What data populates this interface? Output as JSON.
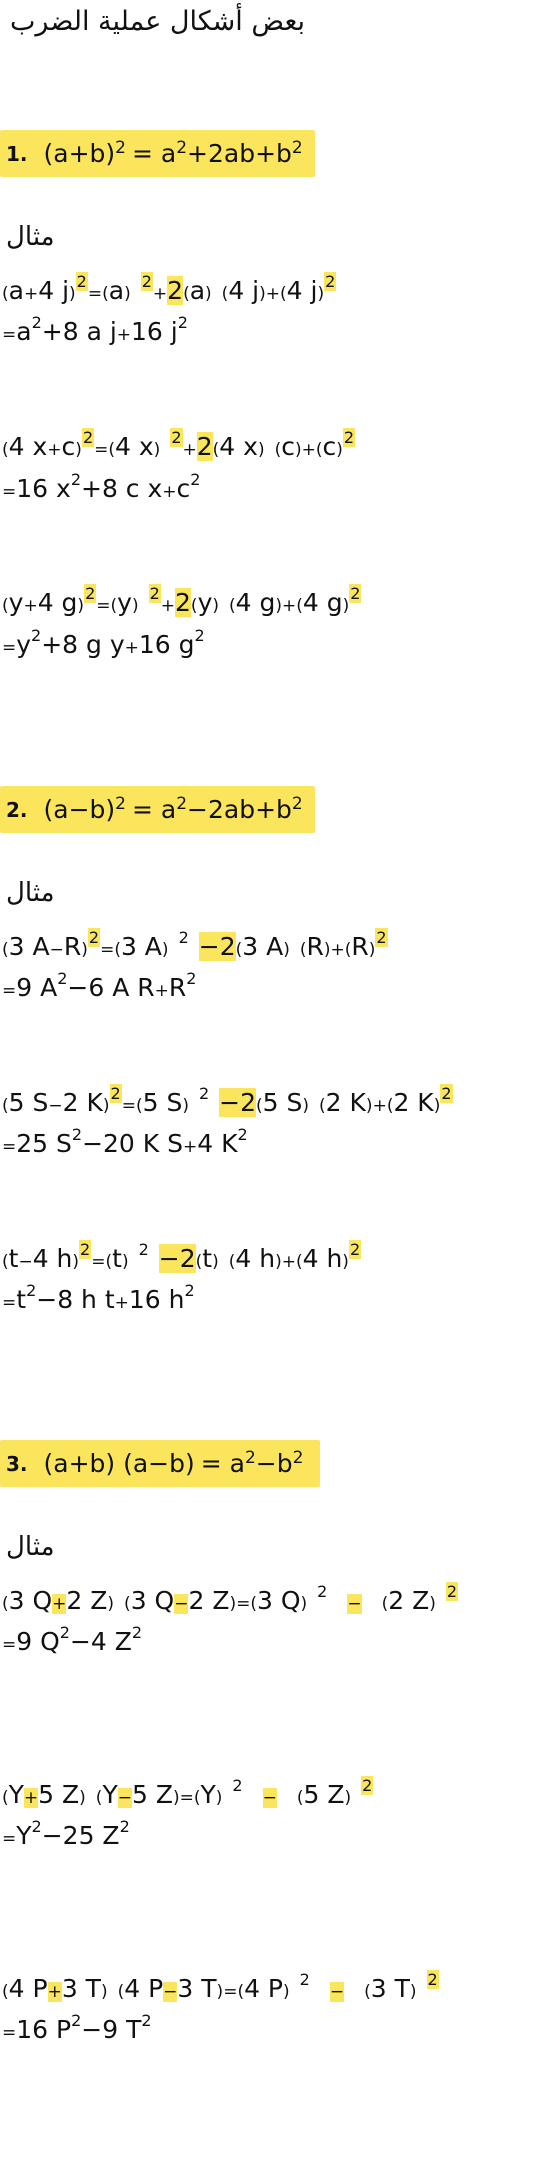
{
  "title": "بعض أشكال عملية الضرب",
  "example_label": "مثال",
  "sections": [
    {
      "num": "1.",
      "formula": {
        "a": "(a+b)",
        "b": "2",
        "c": "=  a",
        "d": "2",
        "e": "+2ab+b",
        "f": "2"
      },
      "examples": [
        {
          "l1": [
            "(",
            "a",
            "+",
            "4 j",
            ")",
            "2",
            "=",
            "(",
            "a",
            ")",
            "2",
            "+",
            "2",
            "(",
            "a",
            ")",
            "(",
            "4 j",
            ")",
            "+",
            "(",
            "4 j",
            ")",
            "2"
          ],
          "l2": [
            "=",
            "a",
            "2",
            "+8 a j",
            "+",
            "16 j",
            "2"
          ]
        },
        {
          "l1": [
            "(",
            "4 x",
            "+",
            "c",
            ")",
            "2",
            "=",
            "(",
            "4 x",
            ")",
            "2",
            "+",
            "2",
            "(",
            "4 x",
            ")",
            "(",
            "c",
            ")",
            "+",
            "(",
            "c",
            ")",
            "2"
          ],
          "l2": [
            "=",
            "16 x",
            "2",
            "+8 c x",
            "+",
            "c",
            "2"
          ]
        },
        {
          "l1": [
            "(",
            "y",
            "+",
            "4 g",
            ")",
            "2",
            "=",
            "(",
            "y",
            ")",
            "2",
            "+",
            "2",
            "(",
            "y",
            ")",
            "(",
            "4 g",
            ")",
            "+",
            "(",
            "4 g",
            ")",
            "2"
          ],
          "l2": [
            "=",
            "y",
            "2",
            "+8 g y",
            "+",
            "16 g",
            "2"
          ]
        }
      ]
    },
    {
      "num": "2.",
      "formula": {
        "a": "(a−b)",
        "b": "2",
        "c": "=  a",
        "d": "2",
        "e": "−2ab+b",
        "f": "2"
      },
      "examples": [
        {
          "l1": [
            "(",
            "3 A",
            "−",
            "R",
            ")",
            "2",
            "=",
            "(",
            "3 A",
            ")",
            "2",
            "−2",
            "(",
            "3 A",
            ")",
            "(",
            "R",
            ")",
            "+",
            "(",
            "R",
            ")",
            "2"
          ],
          "l2": [
            "=",
            "9 A",
            "2",
            "−6 A R",
            "+",
            "R",
            "2"
          ]
        },
        {
          "l1": [
            "(",
            "5 S",
            "−",
            "2 K",
            ")",
            "2",
            "=",
            "(",
            "5 S",
            ")",
            "2",
            "−2",
            "(",
            "5 S",
            ")",
            "(",
            "2 K",
            ")",
            "+",
            "(",
            "2 K",
            ")",
            "2"
          ],
          "l2": [
            "=",
            "25 S",
            "2",
            "−20 K S",
            "+",
            "4 K",
            "2"
          ]
        },
        {
          "l1": [
            "(",
            "t",
            "−",
            "4 h",
            ")",
            "2",
            "=",
            "(",
            "t",
            ")",
            "2",
            "−2",
            "(",
            "t",
            ")",
            "(",
            "4 h",
            ")",
            "+",
            "(",
            "4 h",
            ")",
            "2"
          ],
          "l2": [
            "=",
            "t",
            "2",
            "−8 h t",
            "+",
            "16 h",
            "2"
          ]
        }
      ]
    },
    {
      "num": "3.",
      "formula": {
        "a": "(a+b) (a−b)",
        "b": "",
        "c": "=  a",
        "d": "2",
        "e": "−b",
        "f": "2"
      },
      "examples": [
        {
          "l1": [
            "(",
            "3 Q",
            "+",
            "2 Z",
            ")",
            "(",
            "3 Q",
            "−",
            "2 Z",
            ")",
            "=",
            "(",
            "3 Q",
            ")",
            "2",
            "−",
            "(",
            "2 Z",
            ")",
            "2"
          ],
          "l2": [
            "=",
            "9 Q",
            "2",
            "−4 Z",
            "2"
          ]
        },
        {
          "l1": [
            "(",
            "Y",
            "+",
            "5 Z",
            ")",
            "(",
            "Y",
            "−",
            "5 Z",
            ")",
            "=",
            "(",
            "Y",
            ")",
            "2",
            "−",
            "(",
            "5 Z",
            ")",
            "2"
          ],
          "l2": [
            "=",
            "Y",
            "2",
            "−25 Z",
            "2"
          ]
        },
        {
          "l1": [
            "(",
            "4 P",
            "+",
            "3 T",
            ")",
            "(",
            "4 P",
            "−",
            "3 T",
            ")",
            "=",
            "(",
            "4 P",
            ")",
            "2",
            "−",
            "(",
            "3 T",
            ")",
            "2"
          ],
          "l2": [
            "=",
            "16 P",
            "2",
            "−9 T",
            "2"
          ]
        }
      ]
    }
  ]
}
